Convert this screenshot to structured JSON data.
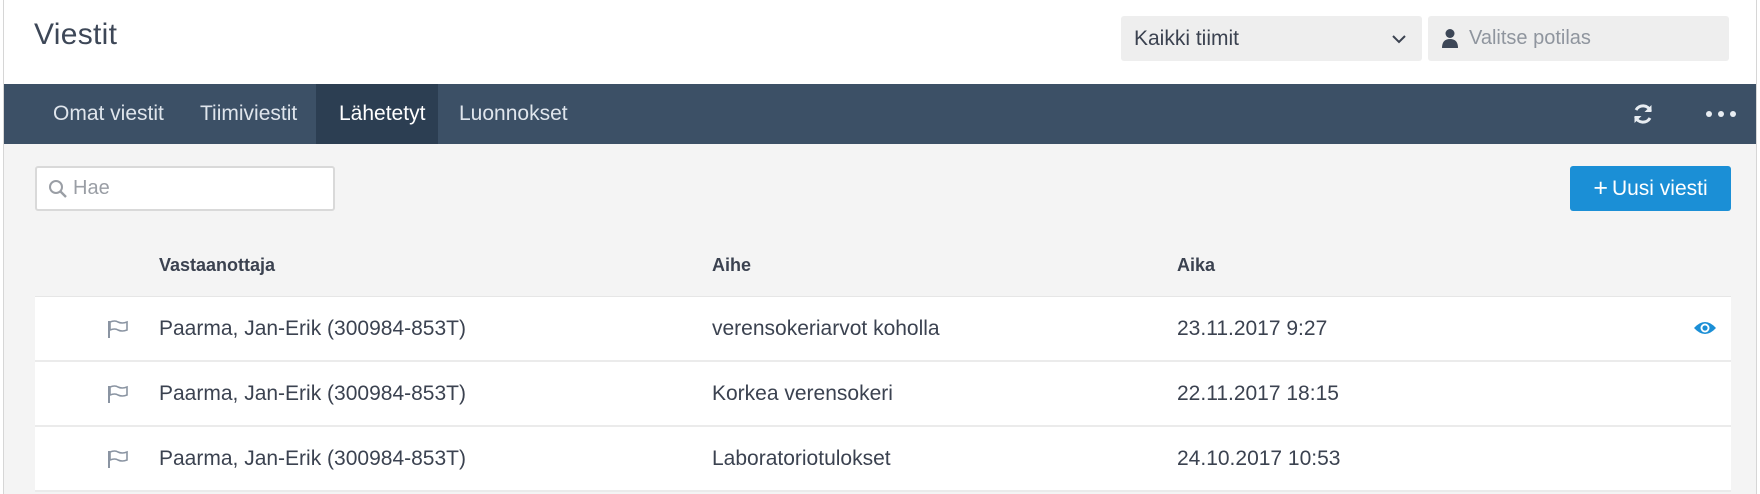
{
  "header": {
    "title": "Viestit",
    "team_select": {
      "selected": "Kaikki tiimit",
      "icon": "chevron-down-icon"
    },
    "patient_select": {
      "placeholder": "Valitse potilas",
      "icon": "user-icon"
    }
  },
  "tabs": [
    {
      "label": "Omat viestit",
      "active": false
    },
    {
      "label": "Tiimiviestit",
      "active": false
    },
    {
      "label": "Lähetetyt",
      "active": true
    },
    {
      "label": "Luonnokset",
      "active": false
    }
  ],
  "toolbar_icons": [
    "refresh-icon",
    "more-icon"
  ],
  "search": {
    "placeholder": "Hae",
    "icon": "search-icon"
  },
  "new_message_button": {
    "plus": "+",
    "label": "Uusi viesti",
    "color": "#1b8fd6"
  },
  "table": {
    "columns": [
      "Vastaanottaja",
      "Aihe",
      "Aika"
    ],
    "rows": [
      {
        "recipient": "Paarma, Jan-Erik  (300984-853T)",
        "subject": "verensokeriarvot koholla",
        "time": "23.11.2017 9:27",
        "read_icon": true
      },
      {
        "recipient": "Paarma, Jan-Erik  (300984-853T)",
        "subject": "Korkea verensokeri",
        "time": "22.11.2017 18:15",
        "read_icon": false
      },
      {
        "recipient": "Paarma, Jan-Erik  (300984-853T)",
        "subject": "Laboratoriotulokset",
        "time": "24.10.2017 10:53",
        "read_icon": false
      }
    ]
  },
  "colors": {
    "nav_bg": "#3c5066",
    "nav_active_bg": "#2c3e52",
    "accent": "#1b8fd6"
  }
}
